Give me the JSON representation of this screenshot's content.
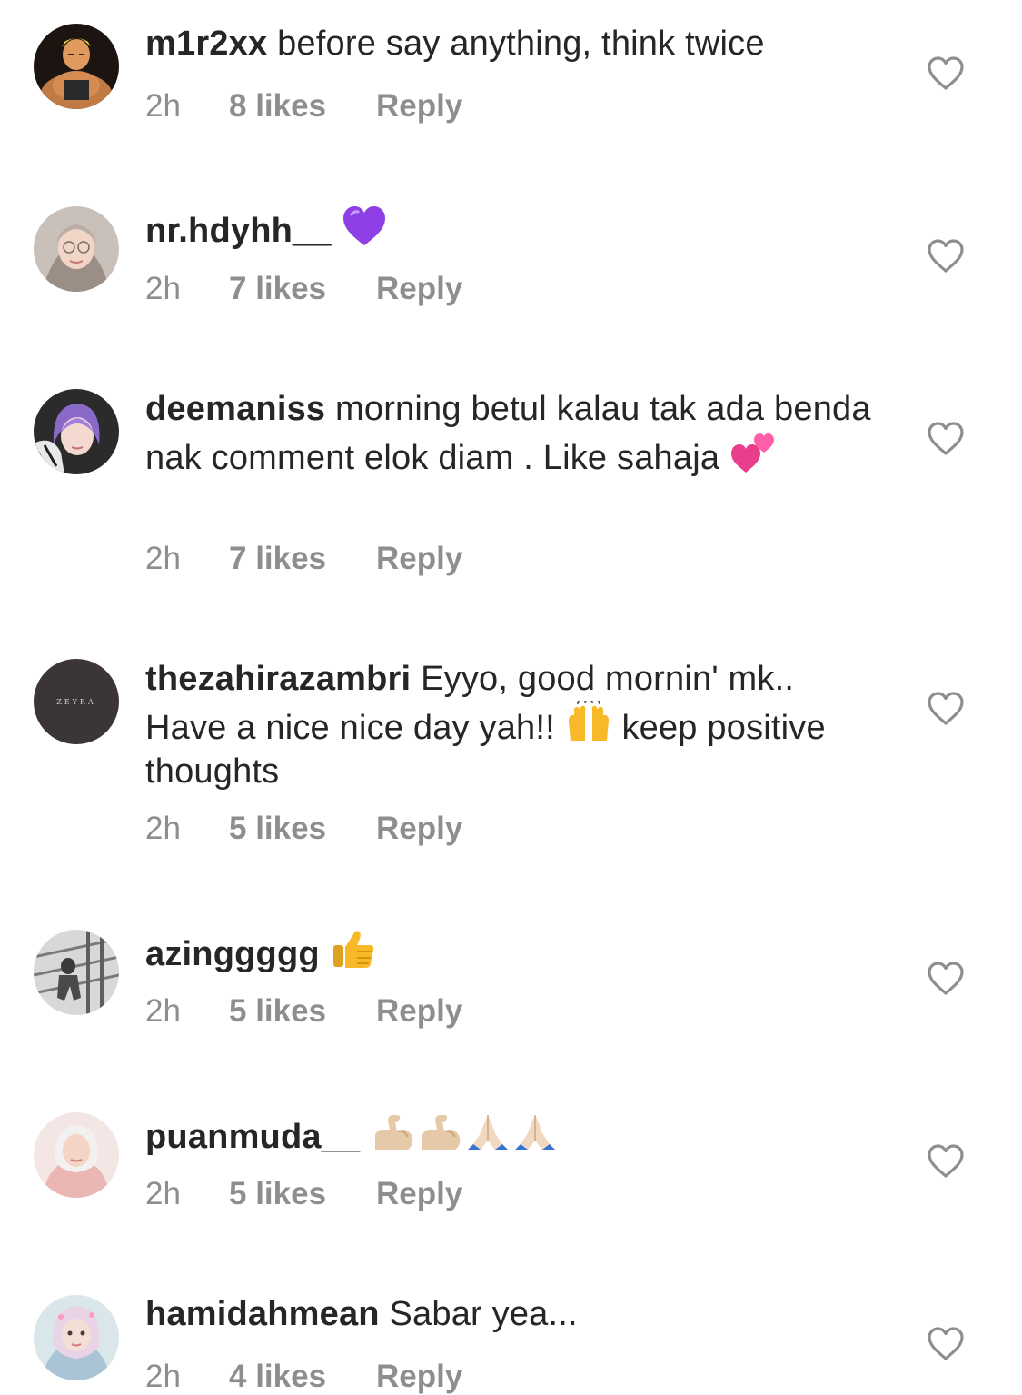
{
  "comments": [
    {
      "username": "m1r2xx",
      "text": "before say anything, think twice",
      "time": "2h",
      "likes": "8 likes",
      "reply": "Reply",
      "avatar_icon": "avatar-muscular-fighter",
      "emojis": []
    },
    {
      "username": "nr.hdyhh__",
      "text": "",
      "time": "2h",
      "likes": "7 likes",
      "reply": "Reply",
      "avatar_icon": "avatar-woman-glasses",
      "emojis": [
        "purple-heart"
      ]
    },
    {
      "username": "deemaniss",
      "text": "morning betul kalau tak ada benda nak comment elok diam . Like sahaja",
      "time": "2h",
      "likes": "7 likes",
      "reply": "Reply",
      "avatar_icon": "avatar-woman-purple-hair",
      "emojis": [
        "two-hearts"
      ]
    },
    {
      "username": "thezahirazambri",
      "text_a": "Eyyo, good mornin' mk.. Have a nice nice day yah!!",
      "text_b": "keep positive thoughts",
      "time": "2h",
      "likes": "5 likes",
      "reply": "Reply",
      "avatar_icon": "avatar-zeyra-logo",
      "avatar_text": "ZEYRA",
      "emojis": [
        "raising-hands"
      ]
    },
    {
      "username": "azinggggg",
      "text": "",
      "time": "2h",
      "likes": "5 likes",
      "reply": "Reply",
      "avatar_icon": "avatar-man-stairs",
      "emojis": [
        "thumbs-up"
      ]
    },
    {
      "username": "puanmuda__",
      "text": "",
      "time": "2h",
      "likes": "5 likes",
      "reply": "Reply",
      "avatar_icon": "avatar-woman-hijab-pink",
      "emojis": [
        "flexed-biceps",
        "flexed-biceps",
        "folded-hands",
        "folded-hands"
      ]
    },
    {
      "username": "hamidahmean",
      "text": "Sabar yea...",
      "time": "2h",
      "likes": "4 likes",
      "reply": "Reply",
      "avatar_icon": "avatar-woman-hijab-filter",
      "emojis": []
    }
  ],
  "colors": {
    "text": "#262626",
    "meta": "#8e8e8e",
    "heart_outline": "#8e8e8e"
  }
}
